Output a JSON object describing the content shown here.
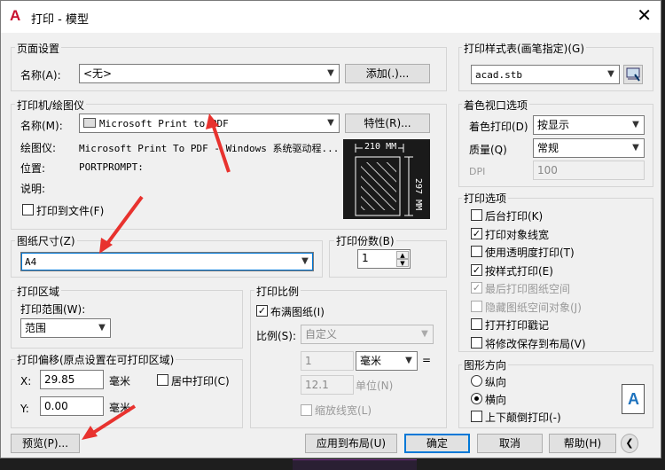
{
  "window": {
    "title": "打印 - 模型",
    "logo": "A",
    "close": "✕"
  },
  "page_setup": {
    "group_label": "页面设置",
    "name_label": "名称(A):",
    "name_value": "<无>",
    "add_button": "添加(.)..."
  },
  "printer": {
    "group_label": "打印机/绘图仪",
    "name_label": "名称(M):",
    "name_value": "Microsoft Print to PDF",
    "properties_button": "特性(R)...",
    "plotter_label": "绘图仪:",
    "plotter_value": "Microsoft Print To PDF - Windows 系统驱动程...",
    "location_label": "位置:",
    "location_value": "PORTPROMPT:",
    "desc_label": "说明:",
    "print_to_file": "打印到文件(F)",
    "preview_width": "210 MM",
    "preview_height": "297 MM"
  },
  "paper_size": {
    "group_label": "图纸尺寸(Z)",
    "value": "A4"
  },
  "copies": {
    "group_label": "打印份数(B)",
    "value": "1"
  },
  "plot_area": {
    "group_label": "打印区域",
    "range_label": "打印范围(W):",
    "range_value": "范围"
  },
  "plot_scale": {
    "group_label": "打印比例",
    "fit_paper": "布满图纸(I)",
    "scale_label": "比例(S):",
    "scale_value": "自定义",
    "value1": "1",
    "unit_value": "毫米",
    "equals": "=",
    "value2": "12.1",
    "unit_label": "单位(N)",
    "scale_lineweights": "缩放线宽(L)"
  },
  "plot_offset": {
    "group_label": "打印偏移(原点设置在可打印区域)",
    "x_label": "X:",
    "x_value": "29.85",
    "x_unit": "毫米",
    "center_plot": "居中打印(C)",
    "y_label": "Y:",
    "y_value": "0.00",
    "y_unit": "毫米"
  },
  "plot_style": {
    "group_label": "打印样式表(画笔指定)(G)",
    "value": "acad.stb"
  },
  "shaded": {
    "group_label": "着色视口选项",
    "shade_label": "着色打印(D)",
    "shade_value": "按显示",
    "quality_label": "质量(Q)",
    "quality_value": "常规",
    "dpi_label": "DPI",
    "dpi_value": "100"
  },
  "options": {
    "group_label": "打印选项",
    "items": [
      {
        "label": "后台打印(K)",
        "checked": false,
        "disabled": false
      },
      {
        "label": "打印对象线宽",
        "checked": true,
        "disabled": false
      },
      {
        "label": "使用透明度打印(T)",
        "checked": false,
        "disabled": false
      },
      {
        "label": "按样式打印(E)",
        "checked": true,
        "disabled": false
      },
      {
        "label": "最后打印图纸空间",
        "checked": true,
        "disabled": true
      },
      {
        "label": "隐藏图纸空间对象(J)",
        "checked": false,
        "disabled": true
      },
      {
        "label": "打开打印戳记",
        "checked": false,
        "disabled": false
      },
      {
        "label": "将修改保存到布局(V)",
        "checked": false,
        "disabled": false
      }
    ]
  },
  "orientation": {
    "group_label": "图形方向",
    "portrait": "纵向",
    "landscape": "横向",
    "upside_down": "上下颠倒打印(-)"
  },
  "buttons": {
    "preview": "预览(P)...",
    "apply": "应用到布局(U)",
    "ok": "确定",
    "cancel": "取消",
    "help": "帮助(H)",
    "more": "❮"
  },
  "colors": {
    "annotation_arrow": "#e8322e",
    "accent": "#0078d7",
    "logo": "#c8102e"
  },
  "icons": [
    "autocad-logo-icon",
    "close-icon",
    "printer-icon",
    "plot-style-edit-icon",
    "orientation-icon",
    "chevron-left-icon"
  ]
}
